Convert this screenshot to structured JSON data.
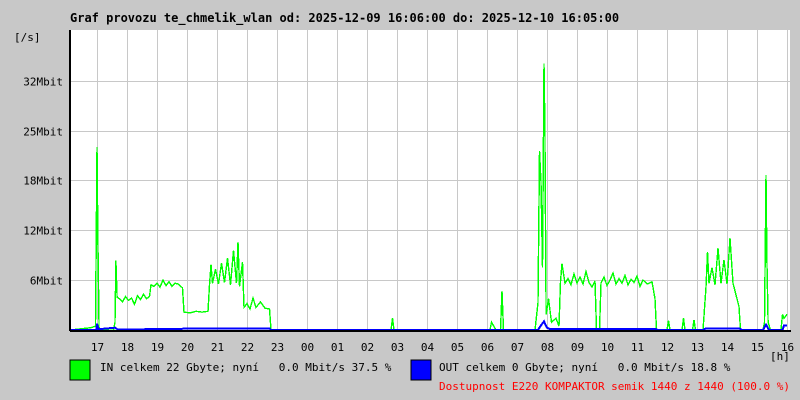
{
  "chart_data": {
    "type": "line",
    "title": "Graf provozu te_chmelik_wlan od: 2025-12-09 16:06:00 do: 2025-12-10 16:05:00",
    "ylabel": "[/s]",
    "xlabel": "[h]",
    "xlim_hours": [
      16.1,
      40.1
    ],
    "ylim_mbit": [
      0,
      38.5
    ],
    "grid": true,
    "yticks": [
      {
        "value": 6.4,
        "label": "6Mbit"
      },
      {
        "value": 12.8,
        "label": "12Mbit"
      },
      {
        "value": 19.2,
        "label": "18Mbit"
      },
      {
        "value": 25.6,
        "label": "25Mbit"
      },
      {
        "value": 32.0,
        "label": "32Mbit"
      }
    ],
    "xticks": [
      {
        "hour": 17,
        "label": "17"
      },
      {
        "hour": 18,
        "label": "18"
      },
      {
        "hour": 19,
        "label": "19"
      },
      {
        "hour": 20,
        "label": "20"
      },
      {
        "hour": 21,
        "label": "21"
      },
      {
        "hour": 22,
        "label": "22"
      },
      {
        "hour": 23,
        "label": "23"
      },
      {
        "hour": 24,
        "label": "00"
      },
      {
        "hour": 25,
        "label": "01"
      },
      {
        "hour": 26,
        "label": "02"
      },
      {
        "hour": 27,
        "label": "03"
      },
      {
        "hour": 28,
        "label": "04"
      },
      {
        "hour": 29,
        "label": "05"
      },
      {
        "hour": 30,
        "label": "06"
      },
      {
        "hour": 31,
        "label": "07"
      },
      {
        "hour": 32,
        "label": "08"
      },
      {
        "hour": 33,
        "label": "09"
      },
      {
        "hour": 34,
        "label": "10"
      },
      {
        "hour": 35,
        "label": "11"
      },
      {
        "hour": 36,
        "label": "12"
      },
      {
        "hour": 37,
        "label": "13"
      },
      {
        "hour": 38,
        "label": "14"
      },
      {
        "hour": 39,
        "label": "15"
      },
      {
        "hour": 40,
        "label": "16"
      }
    ],
    "series": [
      {
        "name": "IN",
        "color": "#00ff00",
        "points": [
          [
            16.1,
            0
          ],
          [
            16.8,
            0.3
          ],
          [
            16.95,
            0.5
          ],
          [
            17.0,
            23.5
          ],
          [
            17.03,
            11.5
          ],
          [
            17.07,
            0
          ],
          [
            17.55,
            0
          ],
          [
            17.6,
            1.0
          ],
          [
            17.63,
            8.9
          ],
          [
            17.67,
            4.2
          ],
          [
            17.75,
            4.0
          ],
          [
            17.85,
            3.6
          ],
          [
            17.95,
            4.3
          ],
          [
            18.05,
            3.8
          ],
          [
            18.15,
            4.1
          ],
          [
            18.25,
            3.3
          ],
          [
            18.35,
            4.4
          ],
          [
            18.45,
            3.9
          ],
          [
            18.55,
            4.6
          ],
          [
            18.65,
            4.0
          ],
          [
            18.75,
            4.3
          ],
          [
            18.8,
            5.8
          ],
          [
            18.9,
            5.6
          ],
          [
            19.0,
            6.0
          ],
          [
            19.1,
            5.5
          ],
          [
            19.2,
            6.4
          ],
          [
            19.3,
            5.7
          ],
          [
            19.4,
            6.2
          ],
          [
            19.5,
            5.6
          ],
          [
            19.6,
            6.0
          ],
          [
            19.7,
            5.9
          ],
          [
            19.85,
            5.4
          ],
          [
            19.9,
            2.3
          ],
          [
            20.1,
            2.2
          ],
          [
            20.3,
            2.4
          ],
          [
            20.5,
            2.3
          ],
          [
            20.7,
            2.4
          ],
          [
            20.75,
            5.8
          ],
          [
            20.8,
            8.4
          ],
          [
            20.85,
            6.0
          ],
          [
            20.95,
            7.8
          ],
          [
            21.05,
            5.9
          ],
          [
            21.15,
            8.6
          ],
          [
            21.25,
            6.1
          ],
          [
            21.35,
            9.2
          ],
          [
            21.45,
            5.8
          ],
          [
            21.55,
            10.2
          ],
          [
            21.65,
            6.0
          ],
          [
            21.7,
            11.3
          ],
          [
            21.75,
            5.6
          ],
          [
            21.85,
            8.7
          ],
          [
            21.9,
            2.9
          ],
          [
            22.0,
            3.4
          ],
          [
            22.1,
            2.7
          ],
          [
            22.2,
            4.1
          ],
          [
            22.3,
            2.9
          ],
          [
            22.45,
            3.6
          ],
          [
            22.6,
            2.8
          ],
          [
            22.75,
            2.7
          ],
          [
            22.8,
            0
          ],
          [
            26.8,
            0
          ],
          [
            26.85,
            1.5
          ],
          [
            26.9,
            0
          ],
          [
            30.1,
            0
          ],
          [
            30.15,
            1.0
          ],
          [
            30.3,
            0
          ],
          [
            30.45,
            0
          ],
          [
            30.5,
            5.0
          ],
          [
            30.55,
            0
          ],
          [
            31.6,
            0
          ],
          [
            31.7,
            3.5
          ],
          [
            31.75,
            23.0
          ],
          [
            31.8,
            19.0
          ],
          [
            31.85,
            8.0
          ],
          [
            31.9,
            34.2
          ],
          [
            31.93,
            26.0
          ],
          [
            31.97,
            2.0
          ],
          [
            32.05,
            4.0
          ],
          [
            32.15,
            1.0
          ],
          [
            32.3,
            1.5
          ],
          [
            32.4,
            0.5
          ],
          [
            32.45,
            6.2
          ],
          [
            32.5,
            8.5
          ],
          [
            32.6,
            6.0
          ],
          [
            32.7,
            6.6
          ],
          [
            32.8,
            5.8
          ],
          [
            32.9,
            7.2
          ],
          [
            33.0,
            6.0
          ],
          [
            33.1,
            6.8
          ],
          [
            33.2,
            5.9
          ],
          [
            33.3,
            7.5
          ],
          [
            33.4,
            6.1
          ],
          [
            33.5,
            5.5
          ],
          [
            33.6,
            6.3
          ],
          [
            33.65,
            0
          ],
          [
            33.75,
            0
          ],
          [
            33.8,
            6.0
          ],
          [
            33.9,
            6.8
          ],
          [
            34.0,
            5.7
          ],
          [
            34.1,
            6.4
          ],
          [
            34.2,
            7.3
          ],
          [
            34.3,
            5.9
          ],
          [
            34.4,
            6.6
          ],
          [
            34.5,
            6.0
          ],
          [
            34.6,
            7.0
          ],
          [
            34.7,
            5.8
          ],
          [
            34.8,
            6.5
          ],
          [
            34.9,
            6.1
          ],
          [
            35.0,
            6.9
          ],
          [
            35.1,
            5.6
          ],
          [
            35.2,
            6.4
          ],
          [
            35.35,
            5.9
          ],
          [
            35.5,
            6.2
          ],
          [
            35.6,
            4.0
          ],
          [
            35.65,
            0
          ],
          [
            36.0,
            0
          ],
          [
            36.05,
            1.2
          ],
          [
            36.1,
            0
          ],
          [
            36.5,
            0
          ],
          [
            36.55,
            1.5
          ],
          [
            36.6,
            0
          ],
          [
            36.85,
            0
          ],
          [
            36.9,
            1.3
          ],
          [
            36.95,
            0
          ],
          [
            37.2,
            0
          ],
          [
            37.3,
            5.5
          ],
          [
            37.35,
            10.0
          ],
          [
            37.4,
            6.0
          ],
          [
            37.5,
            8.0
          ],
          [
            37.6,
            5.8
          ],
          [
            37.7,
            10.5
          ],
          [
            37.8,
            6.0
          ],
          [
            37.9,
            9.0
          ],
          [
            38.0,
            5.9
          ],
          [
            38.1,
            11.8
          ],
          [
            38.2,
            6.0
          ],
          [
            38.3,
            4.5
          ],
          [
            38.4,
            3.0
          ],
          [
            38.45,
            0
          ],
          [
            39.2,
            0
          ],
          [
            39.25,
            1.0
          ],
          [
            39.3,
            19.9
          ],
          [
            39.33,
            9.0
          ],
          [
            39.37,
            1.0
          ],
          [
            39.45,
            0
          ],
          [
            39.8,
            0
          ],
          [
            39.85,
            2.0
          ],
          [
            39.9,
            1.5
          ],
          [
            40.0,
            2.0
          ]
        ]
      },
      {
        "name": "OUT",
        "color": "#0000ff",
        "points": [
          [
            16.1,
            0
          ],
          [
            16.98,
            0
          ],
          [
            17.0,
            0.8
          ],
          [
            17.05,
            0.1
          ],
          [
            17.6,
            0.3
          ],
          [
            17.7,
            0.05
          ],
          [
            20.75,
            0.2
          ],
          [
            21.9,
            0.2
          ],
          [
            22.75,
            0.2
          ],
          [
            22.8,
            0
          ],
          [
            31.7,
            0
          ],
          [
            31.8,
            0.6
          ],
          [
            31.9,
            1.1
          ],
          [
            32.0,
            0.3
          ],
          [
            32.1,
            0.1
          ],
          [
            32.5,
            0.15
          ],
          [
            35.6,
            0.15
          ],
          [
            35.7,
            0
          ],
          [
            37.2,
            0
          ],
          [
            37.3,
            0.2
          ],
          [
            38.4,
            0.2
          ],
          [
            38.5,
            0
          ],
          [
            39.2,
            0
          ],
          [
            39.3,
            0.7
          ],
          [
            39.4,
            0
          ],
          [
            39.85,
            0
          ],
          [
            39.9,
            0.6
          ],
          [
            40.0,
            0.6
          ]
        ]
      }
    ]
  },
  "legend": {
    "in": {
      "text": "IN celkem 22 Gbyte; nyní   0.0 Mbit/s 37.5 %",
      "color": "#00ff00"
    },
    "out": {
      "text": "OUT celkem 0 Gbyte; nyní   0.0 Mbit/s 18.8 %",
      "color": "#0000ff"
    },
    "availability": {
      "text": "Dostupnost E220 KOMPAKTOR semik 1440 z 1440 (100.0 %)",
      "color": "#ff0000"
    }
  }
}
